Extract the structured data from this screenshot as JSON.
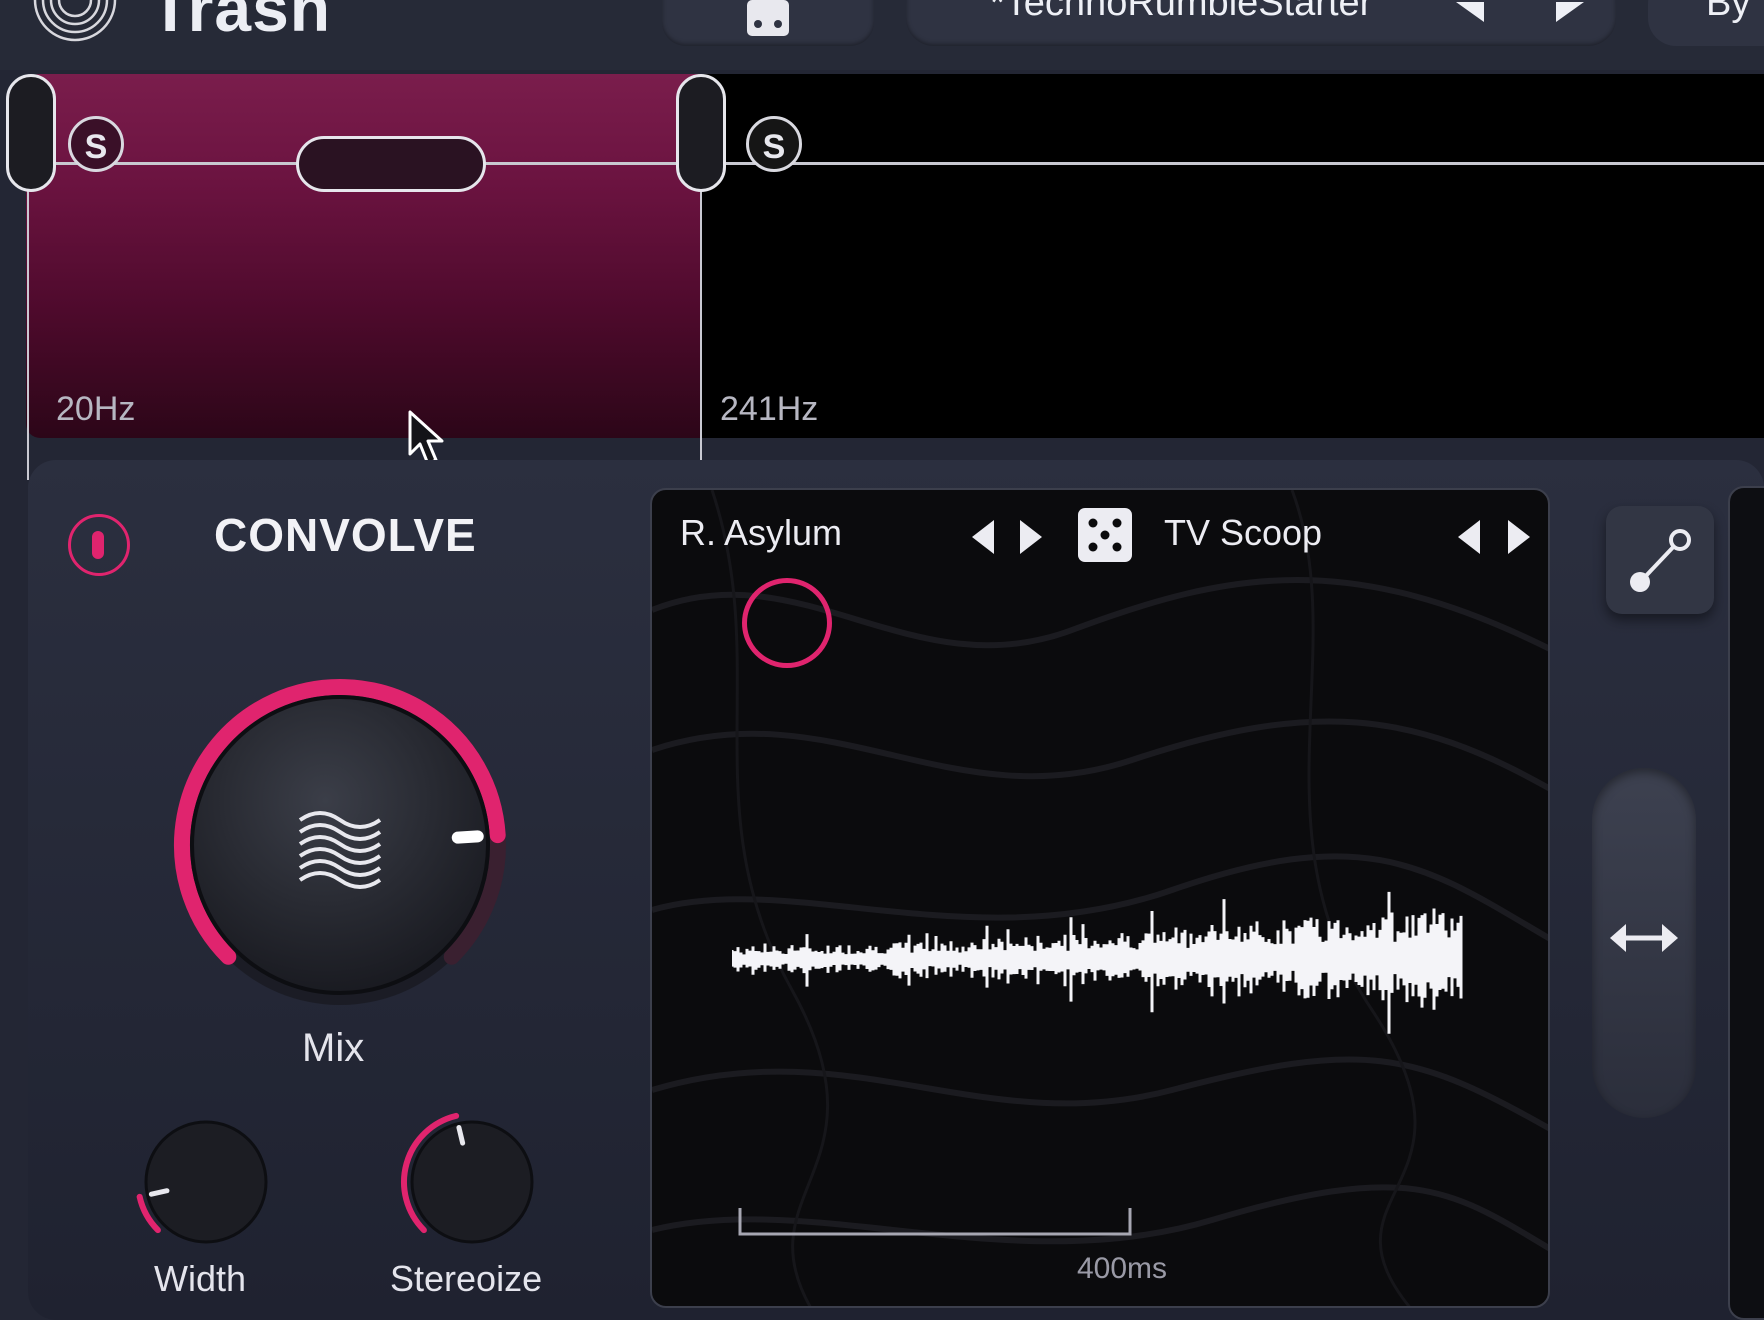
{
  "header": {
    "app_title": "Trash",
    "preset_name": "*TechnoRumbleStarter",
    "bypass_label": "By"
  },
  "bands": [
    {
      "solo_label": "S",
      "freq_label": "20Hz"
    },
    {
      "solo_label": "S",
      "freq_label": "241Hz"
    }
  ],
  "module": {
    "title": "CONVOLVE",
    "mix_label": "Mix",
    "width_label": "Width",
    "stereoize_label": "Stereoize",
    "mix_value_pct": 82,
    "width_value_pct": 12,
    "stereoize_value_pct": 45
  },
  "ir": {
    "left_name": "R. Asylum",
    "right_name": "TV Scoop",
    "scale_label": "400ms"
  },
  "icons": {
    "logo": "fingerprint-logo-icon",
    "dice": "dice-icon",
    "prev": "triangle-left-icon",
    "next": "triangle-right-icon",
    "power": "power-icon",
    "link": "link-icon",
    "width_slider": "double-arrow-icon",
    "cursor": "mouse-pointer-icon"
  },
  "colors": {
    "accent": "#e0246e",
    "band_fill": "#6b1340",
    "background": "#232634"
  }
}
